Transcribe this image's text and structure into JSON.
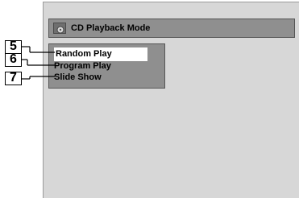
{
  "window": {
    "title": "CD Playback Mode",
    "icon": "cd-disc-icon"
  },
  "menu": {
    "items": [
      {
        "label": "Random Play",
        "selected": true
      },
      {
        "label": "Program Play",
        "selected": false
      },
      {
        "label": "Slide Show",
        "selected": false
      }
    ]
  },
  "callouts": [
    "5",
    "6",
    "7"
  ],
  "colors": {
    "screen_bg": "#d7d7d7",
    "panel_bg": "#8f8f8f",
    "highlight": "#ffffff"
  }
}
